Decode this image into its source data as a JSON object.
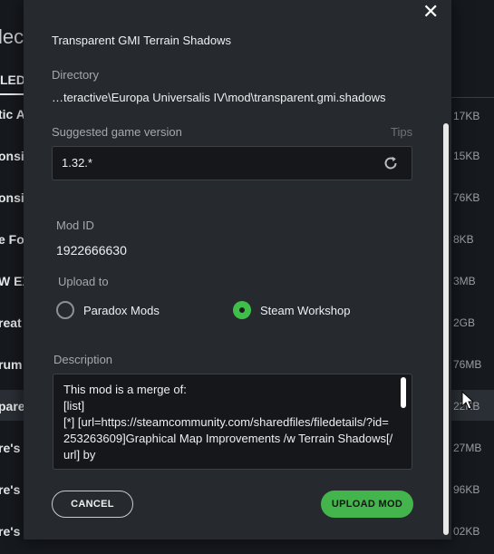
{
  "background": {
    "title_fragment": "lec",
    "column_header": "LED",
    "rows": [
      {
        "name": "tic A",
        "size": "17KB"
      },
      {
        "name": "onsil",
        "size": "15KB"
      },
      {
        "name": "onsil",
        "size": "76KB"
      },
      {
        "name": "e Fo",
        "size": "8KB"
      },
      {
        "name": "W EX",
        "size": "3MB"
      },
      {
        "name": "reat",
        "size": "2GB"
      },
      {
        "name": "rum",
        "size": "76MB"
      },
      {
        "name": "pare",
        "size": "22KB"
      },
      {
        "name": "re's",
        "size": "27MB"
      },
      {
        "name": "re's",
        "size": "96KB"
      },
      {
        "name": "re's",
        "size": "02KB"
      }
    ]
  },
  "modal": {
    "mod_name": "Transparent GMI Terrain Shadows",
    "directory_label": "Directory",
    "directory_value": "…teractive\\Europa Universalis IV\\mod\\transparent.gmi.shadows",
    "version_label": "Suggested game version",
    "tips_label": "Tips",
    "version_value": "1.32.*",
    "mod_id_label": "Mod ID",
    "mod_id_value": "1922666630",
    "upload_to_label": "Upload to",
    "upload_options": [
      {
        "label": "Paradox Mods",
        "selected": false
      },
      {
        "label": "Steam Workshop",
        "selected": true
      }
    ],
    "description_label": "Description",
    "description_text": "This mod is a merge of:\n[list]\n[*] [url=https://steamcommunity.com/sharedfiles/filedetails/?id=253263609]Graphical Map Improvements /w Terrain Shadows[/url] by",
    "cancel_label": "CANCEL",
    "upload_label": "UPLOAD MOD"
  },
  "colors": {
    "accent_green": "#43b54c",
    "modal_bg": "#26292e",
    "input_bg": "#15171a"
  },
  "icons": {
    "close": "close-icon",
    "reset": "reset-icon",
    "cursor": "mouse-cursor-icon"
  }
}
